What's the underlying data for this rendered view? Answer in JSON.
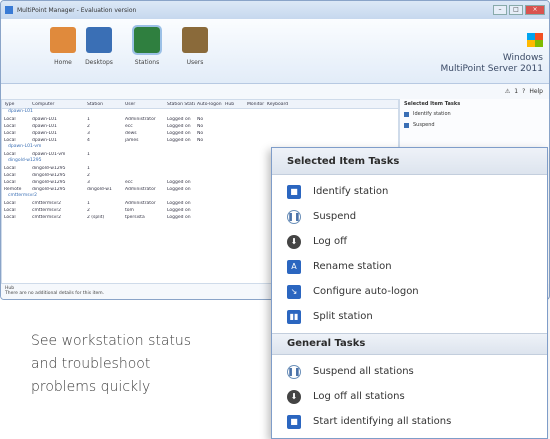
{
  "window": {
    "title": "MultiPoint Manager - Evaluation version",
    "controls": [
      "–",
      "□",
      "×"
    ]
  },
  "ribbon": {
    "tabs": [
      {
        "label": "Home",
        "icon": "house-icon",
        "color": "#e08a3c"
      },
      {
        "label": "Desktops",
        "icon": "desktops-icon",
        "color": "#3a6fb5"
      },
      {
        "label": "Stations",
        "icon": "stations-icon",
        "color": "#2f7f3f"
      },
      {
        "label": "Users",
        "icon": "users-icon",
        "color": "#8a6a3a"
      }
    ],
    "active_tab": "Stations",
    "brand_line1": "Windows",
    "brand_line2": "MultiPoint Server 2011"
  },
  "strip": {
    "alert_count": "1",
    "help_label": "Help"
  },
  "grid": {
    "columns": [
      "Type",
      "Computer",
      "Station",
      "User",
      "Station Status",
      "Auto-logon",
      "Hub",
      "Monitor",
      "Keyboard"
    ],
    "groups": [
      {
        "name": "dpawn-L01",
        "rows": [
          [
            "Local",
            "dpawn-L01",
            "1",
            "Administrator",
            "Logged on",
            "No",
            "",
            "",
            ""
          ],
          [
            "Local",
            "dpawn-L01",
            "2",
            "ecc",
            "Logged on",
            "No",
            "",
            "",
            ""
          ],
          [
            "Local",
            "dpawn-L01",
            "3",
            "dews",
            "Logged on",
            "No",
            "",
            "",
            ""
          ],
          [
            "Local",
            "dpawn-L01",
            "4",
            "james",
            "Logged on",
            "No",
            "",
            "",
            ""
          ]
        ]
      },
      {
        "name": "dpawn-L01-vm",
        "rows": [
          [
            "Local",
            "dpawn-L01-vm",
            "1",
            "",
            "",
            "",
            "",
            "",
            ""
          ]
        ]
      },
      {
        "name": "dingold-w1295",
        "rows": [
          [
            "Local",
            "dingold-w1295",
            "1",
            "",
            "",
            "",
            "",
            "",
            ""
          ],
          [
            "Local",
            "dingold-w1295",
            "2",
            "",
            "",
            "",
            "",
            "",
            ""
          ],
          [
            "Local",
            "dingold-w1295",
            "3",
            "ecc",
            "Logged on",
            "",
            "",
            "",
            ""
          ],
          [
            "Remote",
            "dingold-w1295",
            "dingold-w1",
            "Administrator",
            "Logged on",
            "",
            "",
            "",
            ""
          ]
        ]
      },
      {
        "name": "cmttermsvr2",
        "rows": [
          [
            "Local",
            "cmttermsvr2",
            "1",
            "Administrator",
            "Logged on",
            "",
            "",
            "",
            ""
          ],
          [
            "Local",
            "cmttermsvr2",
            "2",
            "tom",
            "Logged on",
            "",
            "",
            "",
            ""
          ],
          [
            "Local",
            "cmttermsvr2",
            "2 (split)",
            "tpersista",
            "Logged on",
            "",
            "",
            "",
            ""
          ]
        ]
      }
    ]
  },
  "right_pane": {
    "header": "Selected Item Tasks",
    "items": [
      "Identify station",
      "Suspend"
    ]
  },
  "statusbar": {
    "line1": "Hub",
    "line2": "There are no additional details for this item."
  },
  "caption": {
    "line1": "See workstation status",
    "line2": "and troubleshoot",
    "line3": "problems quickly"
  },
  "panel": {
    "selected_header": "Selected Item Tasks",
    "selected_items": [
      {
        "label": "Identify station",
        "icon": "identify-station-icon",
        "style": "sq",
        "glyph": "■"
      },
      {
        "label": "Suspend",
        "icon": "suspend-icon",
        "style": "circ",
        "glyph": "❚❚"
      },
      {
        "label": "Log off",
        "icon": "log-off-icon",
        "style": "down",
        "glyph": "⬇"
      },
      {
        "label": "Rename station",
        "icon": "rename-station-icon",
        "style": "sq",
        "glyph": "A"
      },
      {
        "label": "Configure auto-logon",
        "icon": "configure-autologon-icon",
        "style": "sq",
        "glyph": "↘"
      },
      {
        "label": "Split station",
        "icon": "split-station-icon",
        "style": "sq",
        "glyph": "▮▮"
      }
    ],
    "general_header": "General Tasks",
    "general_items": [
      {
        "label": "Suspend all stations",
        "icon": "suspend-all-icon",
        "style": "circ",
        "glyph": "❚❚"
      },
      {
        "label": "Log off all stations",
        "icon": "log-off-all-icon",
        "style": "down",
        "glyph": "⬇"
      },
      {
        "label": "Start identifying all stations",
        "icon": "identify-all-icon",
        "style": "sq",
        "glyph": "■"
      }
    ]
  }
}
